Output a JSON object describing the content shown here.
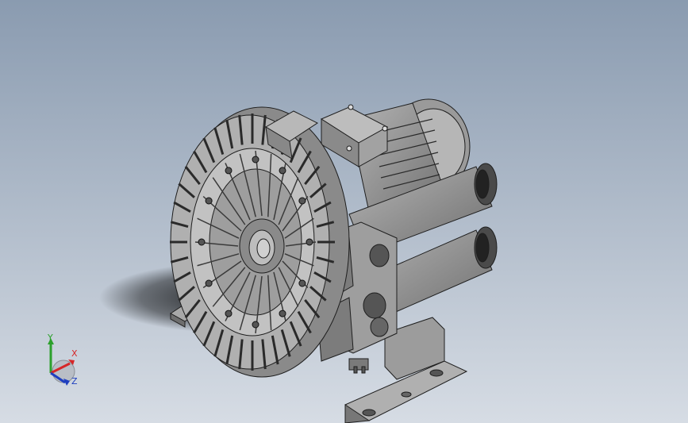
{
  "viewport": {
    "background_top": "#8a9bb0",
    "background_bottom": "#d5dbe3"
  },
  "model": {
    "icon": "side-channel-blower-3d-model",
    "body_color": "#8c8c8c",
    "edge_color": "#1e1e1e"
  },
  "triad": {
    "x_label": "X",
    "y_label": "Y",
    "z_label": "Z",
    "x_color": "#d62728",
    "y_color": "#2ca02c",
    "z_color": "#1f3fbf"
  }
}
